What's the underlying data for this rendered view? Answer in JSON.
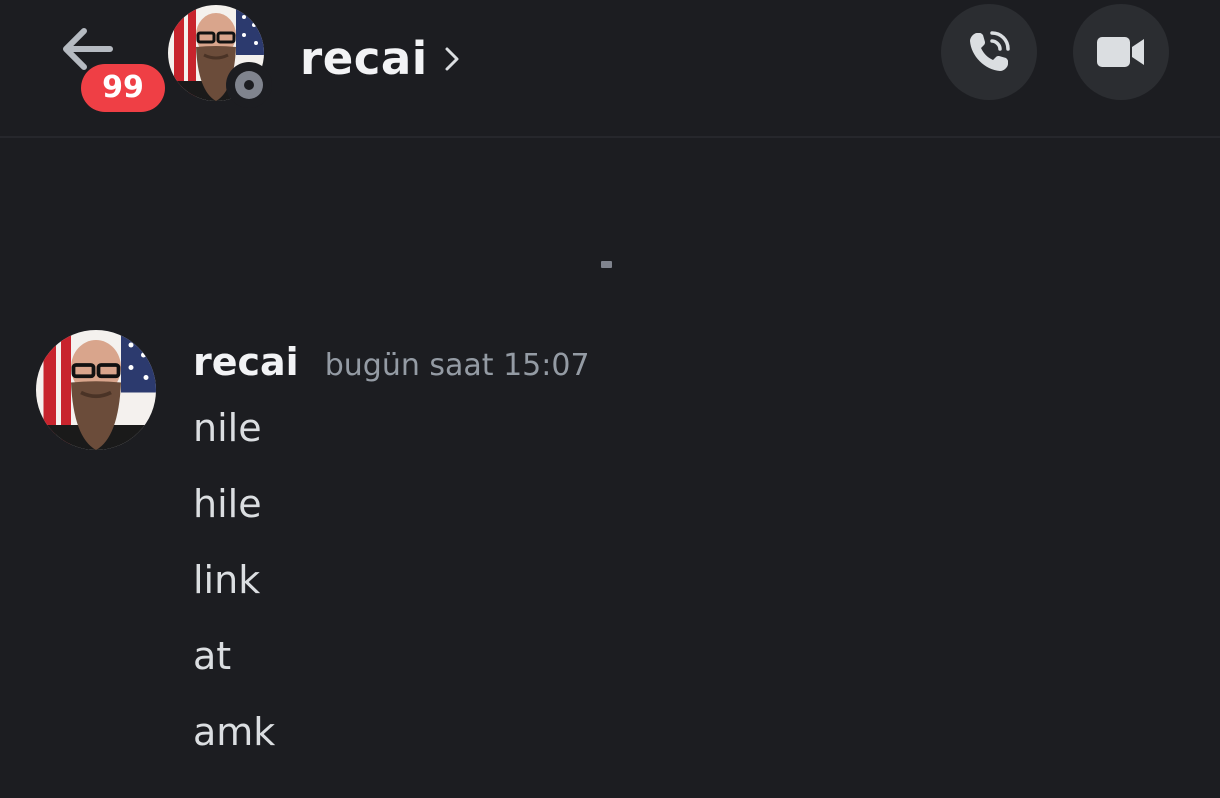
{
  "header": {
    "unread_count": "99",
    "channel_title": "recai",
    "back_icon": "arrow-left-icon",
    "call_icon": "phone-call-icon",
    "video_icon": "video-camera-icon",
    "status": "offline"
  },
  "messages": [
    {
      "author": "recai",
      "timestamp": "bugün saat 15:07",
      "lines": [
        "nile",
        "hile",
        "link",
        "at",
        "amk"
      ]
    }
  ],
  "colors": {
    "background": "#1c1d21",
    "badge": "#ef3f45",
    "button_bg": "#2b2d31",
    "muted": "#949ba4",
    "text": "#dbdee1"
  }
}
